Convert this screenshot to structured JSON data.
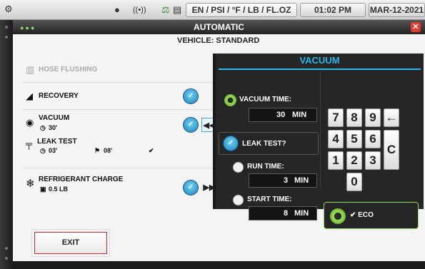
{
  "statusbar": {
    "units": "EN / PSI / °F / LB / FL.OZ",
    "time": "01:02 PM",
    "date": "MAR-12-2021",
    "icons": [
      "gear-icon",
      "wireless-icon",
      "scale-icon",
      "printer-icon"
    ]
  },
  "window": {
    "title": "AUTOMATIC",
    "vehicle": "VEHICLE: STANDARD"
  },
  "steps": {
    "hose_flushing": "HOSE FLUSHING",
    "recovery": "RECOVERY",
    "vacuum": {
      "label": "VACUUM",
      "time": "30'"
    },
    "leak_test": {
      "label": "LEAK TEST",
      "run": "03'",
      "start": "08'"
    },
    "refrigerant_charge": {
      "label": "REFRIGERANT CHARGE",
      "amount": "0.5 LB"
    }
  },
  "panel": {
    "title": "VACUUM",
    "vacuum_time": {
      "label": "VACUUM TIME:",
      "value": "30",
      "unit": "MIN"
    },
    "leak_test": {
      "label": "LEAK TEST?"
    },
    "run_time": {
      "label": "RUN TIME:",
      "value": "3",
      "unit": "MIN"
    },
    "start_time": {
      "label": "START TIME:",
      "value": "8",
      "unit": "MIN"
    },
    "keypad": [
      "7",
      "8",
      "9",
      "←",
      "4",
      "5",
      "6",
      "C",
      "1",
      "2",
      "3",
      "0"
    ],
    "eco_label": "ECO"
  },
  "footer": {
    "exit_label": "EXIT"
  },
  "colors": {
    "accent": "#29b5e8",
    "eco": "#8ad85a",
    "close": "#e53b2f",
    "exit_border": "#c42a2a"
  }
}
